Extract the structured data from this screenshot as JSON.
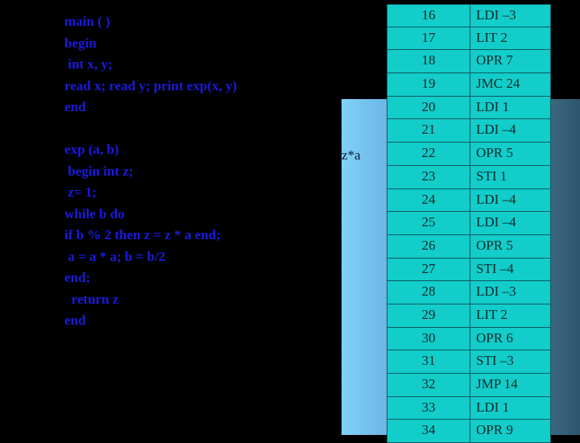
{
  "code_lines": [
    "main ( )",
    "begin",
    " int x, y;",
    "read x; read y; print exp(x, y)",
    "end",
    "",
    "exp (a, b)",
    " begin int z;",
    " z= 1;",
    "while b do",
    "if b % 2 then z = z * a end;",
    " a = a * a; b = b/2",
    "end;",
    "  return z",
    "end"
  ],
  "panel_text": "z*a",
  "table": [
    {
      "addr": "16",
      "instr": "LDI –3"
    },
    {
      "addr": "17",
      "instr": "LIT 2"
    },
    {
      "addr": "18",
      "instr": "OPR 7"
    },
    {
      "addr": "19",
      "instr": "JMC 24"
    },
    {
      "addr": "20",
      "instr": "LDI 1"
    },
    {
      "addr": "21",
      "instr": "LDI –4"
    },
    {
      "addr": "22",
      "instr": "OPR 5"
    },
    {
      "addr": "23",
      "instr": "STI 1"
    },
    {
      "addr": "24",
      "instr": "LDI –4"
    },
    {
      "addr": "25",
      "instr": "LDI –4"
    },
    {
      "addr": "26",
      "instr": "OPR 5"
    },
    {
      "addr": "27",
      "instr": "STI –4"
    },
    {
      "addr": "28",
      "instr": "LDI –3"
    },
    {
      "addr": "29",
      "instr": "LIT 2"
    },
    {
      "addr": "30",
      "instr": "OPR 6"
    },
    {
      "addr": "31",
      "instr": "STI –3"
    },
    {
      "addr": "32",
      "instr": "JMP 14"
    },
    {
      "addr": "33",
      "instr": "LDI 1"
    },
    {
      "addr": "34",
      "instr": "OPR 9"
    }
  ],
  "colors": {
    "background": "#000000",
    "code_text": "#1a1adf",
    "table_cell": "#12cdc9",
    "table_border": "#0e5a60"
  }
}
